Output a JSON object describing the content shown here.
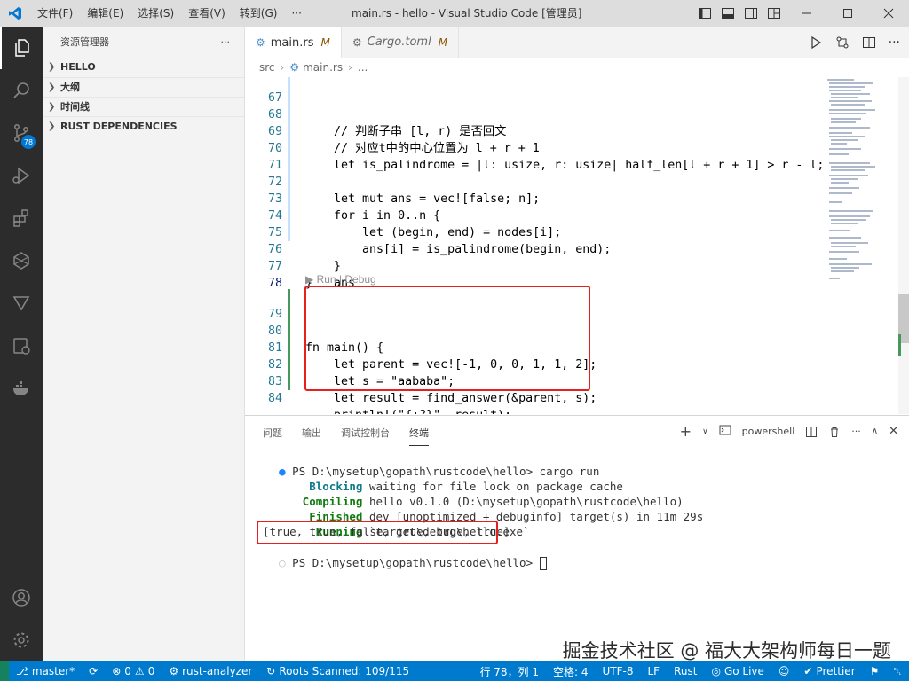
{
  "titlebar": {
    "menus": [
      "文件(F)",
      "编辑(E)",
      "选择(S)",
      "查看(V)",
      "转到(G)",
      "···"
    ],
    "title": "main.rs - hello - Visual Studio Code [管理员]"
  },
  "activity": {
    "source_control_badge": "78"
  },
  "sidebar": {
    "header": "资源管理器",
    "more": "···",
    "sections": [
      "HELLO",
      "大纲",
      "时间线",
      "RUST DEPENDENCIES"
    ]
  },
  "tabs": [
    {
      "label": "main.rs",
      "status": "M"
    },
    {
      "label": "Cargo.toml",
      "status": "M"
    }
  ],
  "breadcrumb": {
    "folder": "src",
    "file": "main.rs",
    "more": "..."
  },
  "editor": {
    "lines": [
      {
        "n": "67",
        "text": "    // 判断子串 [l, r) 是否回文"
      },
      {
        "n": "68",
        "text": "    // 对应t中的中心位置为 l + r + 1"
      },
      {
        "n": "69",
        "text": "    let is_palindrome = |l: usize, r: usize| half_len[l + r + 1] > r - l;"
      },
      {
        "n": "70",
        "text": ""
      },
      {
        "n": "71",
        "text": "    let mut ans = vec![false; n];"
      },
      {
        "n": "72",
        "text": "    for i in 0..n {"
      },
      {
        "n": "73",
        "text": "        let (begin, end) = nodes[i];"
      },
      {
        "n": "74",
        "text": "        ans[i] = is_palindrome(begin, end);"
      },
      {
        "n": "75",
        "text": "    }"
      },
      {
        "n": "76",
        "text": "    ans"
      },
      {
        "n": "77",
        "text": "}"
      },
      {
        "n": "78",
        "text": ""
      },
      {
        "n": "79",
        "text": "fn main() {"
      },
      {
        "n": "80",
        "text": "    let parent = vec![-1, 0, 0, 1, 1, 2];"
      },
      {
        "n": "81",
        "text": "    let s = \"aababa\";"
      },
      {
        "n": "82",
        "text": "    let result = find_answer(&parent, s);"
      },
      {
        "n": "83",
        "text": "    println!(\"{:?}\", result);"
      },
      {
        "n": "84",
        "text": "}"
      }
    ],
    "codelens": "▶ Run | Debug"
  },
  "panel": {
    "tabs": [
      "问题",
      "输出",
      "调试控制台",
      "终端"
    ],
    "active_tab": "终端",
    "terminal_name": "powershell",
    "terminal": [
      {
        "label": "",
        "text": "PS D:\\mysetup\\gopath\\rustcode\\hello> cargo run"
      },
      {
        "label": "    Blocking",
        "text": " waiting for file lock on package cache"
      },
      {
        "label": "   Compiling",
        "text": " hello v0.1.0 (D:\\mysetup\\gopath\\rustcode\\hello)"
      },
      {
        "label": "    Finished",
        "text": " dev [unoptimized + debuginfo] target(s) in 11m 29s"
      },
      {
        "label": "     Running",
        "text": " `target\\debug\\hello.exe`"
      },
      {
        "label": "",
        "text": "[true, true, false, true, true, true]"
      },
      {
        "label": "",
        "text": "PS D:\\mysetup\\gopath\\rustcode\\hello> "
      }
    ]
  },
  "watermark": "掘金技术社区 @ 福大大架构师每日一题",
  "statusbar": {
    "branch": "master*",
    "errors": "0",
    "warnings": "0",
    "analyzer": "rust-analyzer",
    "roots": "Roots Scanned: 109/115",
    "position": "行 78，列 1",
    "spaces": "空格: 4",
    "encoding": "UTF-8",
    "eol": "LF",
    "language": "Rust",
    "golive": "Go Live",
    "prettier": "Prettier"
  },
  "colors": {
    "accent": "#007acc",
    "highlight_box": "#e5201f"
  }
}
